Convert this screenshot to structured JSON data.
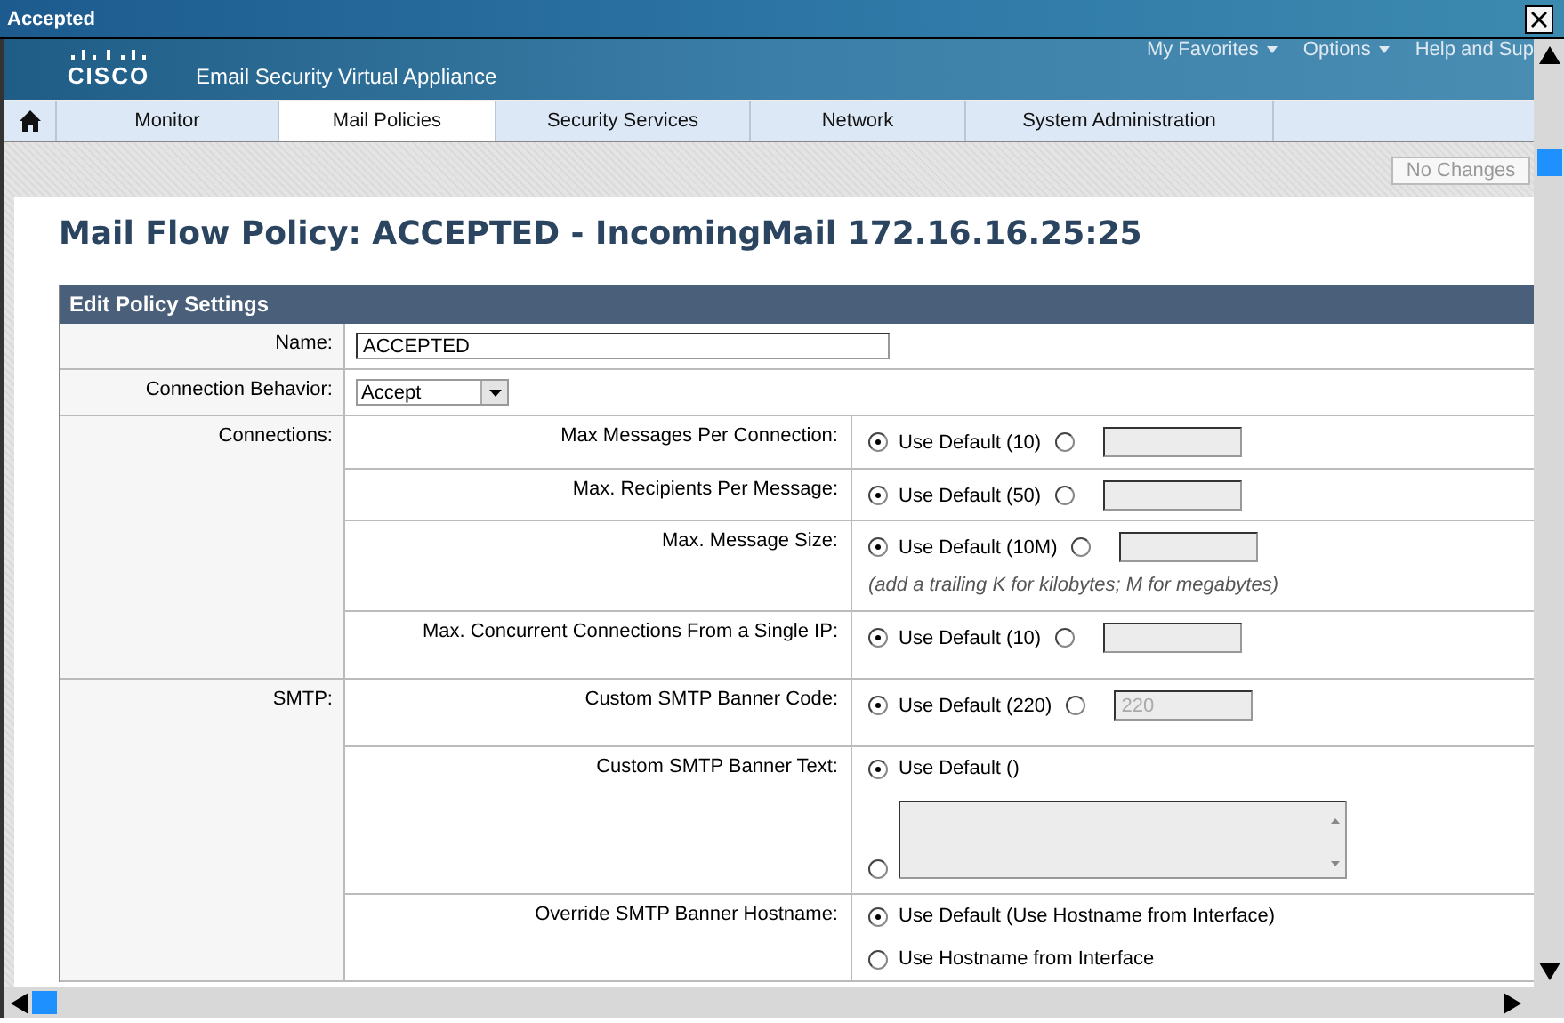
{
  "window": {
    "title": "Accepted"
  },
  "header": {
    "logo": "CISCO",
    "product": "Email Security Virtual Appliance",
    "links": [
      {
        "label": "My Favorites",
        "has_menu": true
      },
      {
        "label": "Options",
        "has_menu": true
      },
      {
        "label": "Help and Sup",
        "has_menu": false
      }
    ]
  },
  "tabs": [
    {
      "label": "Monitor",
      "selected": false
    },
    {
      "label": "Mail Policies",
      "selected": true
    },
    {
      "label": "Security Services",
      "selected": false
    },
    {
      "label": "Network",
      "selected": false
    },
    {
      "label": "System Administration",
      "selected": false
    }
  ],
  "commit_button": {
    "label": "No Changes",
    "disabled": true
  },
  "page_title": "Mail Flow Policy: ACCEPTED - IncomingMail 172.16.16.25:25",
  "panel": {
    "title": "Edit Policy Settings",
    "rows": [
      {
        "kind": "text",
        "label": "Name:",
        "value": "ACCEPTED"
      },
      {
        "kind": "select",
        "label": "Connection Behavior:",
        "value": "Accept"
      },
      {
        "kind": "group",
        "label": "Connections:",
        "items": [
          {
            "label": "Max  Messages Per Connection:",
            "inline": true,
            "options": [
              {
                "label": "Use Default (10)",
                "selected": true
              },
              {
                "selected": false,
                "field": {
                  "kind": "input"
                }
              }
            ]
          },
          {
            "label": "Max. Recipients Per Message:",
            "inline": true,
            "options": [
              {
                "label": "Use Default (50)",
                "selected": true
              },
              {
                "selected": false,
                "field": {
                  "kind": "input"
                }
              }
            ]
          },
          {
            "label": "Max. Message Size:",
            "inline": true,
            "hint": "(add a trailing K for kilobytes; M for megabytes)",
            "options": [
              {
                "label": "Use Default (10M)",
                "selected": true
              },
              {
                "selected": false,
                "field": {
                  "kind": "input"
                }
              }
            ]
          },
          {
            "label": "Max. Concurrent Connections From a Single IP:",
            "inline": true,
            "options": [
              {
                "label": "Use Default (10)",
                "selected": true
              },
              {
                "selected": false,
                "field": {
                  "kind": "input"
                }
              }
            ]
          }
        ]
      },
      {
        "kind": "group",
        "label": "SMTP:",
        "items": [
          {
            "label": "Custom SMTP Banner Code:",
            "inline": true,
            "options": [
              {
                "label": "Use Default (220)",
                "selected": true
              },
              {
                "selected": false,
                "field": {
                  "kind": "input",
                  "value": "220",
                  "disabled": true
                }
              }
            ]
          },
          {
            "label": "Custom SMTP Banner Text:",
            "inline": false,
            "options": [
              {
                "label": "Use Default ()",
                "selected": true
              },
              {
                "selected": false,
                "field": {
                  "kind": "textarea"
                }
              }
            ]
          },
          {
            "label": "Override SMTP Banner Hostname:",
            "inline": false,
            "options": [
              {
                "label": "Use Default (Use Hostname from Interface)",
                "selected": true
              },
              {
                "label": "Use Hostname from Interface",
                "selected": false
              }
            ]
          }
        ]
      }
    ]
  }
}
